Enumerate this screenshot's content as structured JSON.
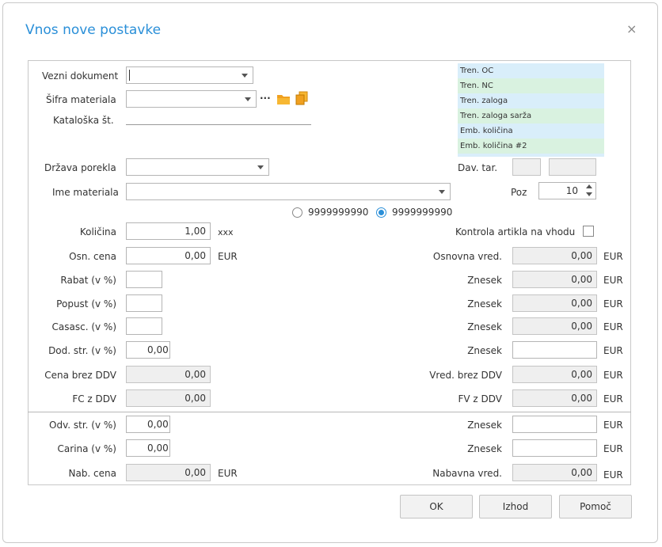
{
  "dialog": {
    "title": "Vnos nove postavke",
    "close": "×"
  },
  "top": {
    "vezni_label": "Vezni dokument",
    "sifra_label": "Šifra materiala",
    "kataloska_label": "Kataloška št.",
    "drzava_label": "Država porekla",
    "ime_label": "Ime materiala",
    "ellipsis": "···",
    "dav_tar_label": "Dav. tar.",
    "poz_label": "Poz",
    "poz_value": "10"
  },
  "list": [
    "Tren. OC",
    "Tren. NC",
    "Tren. zaloga",
    "Tren. zaloga sarža",
    "Emb. količina",
    "Emb. količina #2"
  ],
  "radios": {
    "option1": "9999999990",
    "option2": "9999999990"
  },
  "left": {
    "kolicina_label": "Količina",
    "kolicina_value": "1,00",
    "kolicina_unit": "xxx",
    "osn_cena_label": "Osn. cena",
    "osn_cena_value": "0,00",
    "osn_cena_unit": "EUR",
    "rabat_label": "Rabat (v %)",
    "popust_label": "Popust (v %)",
    "casasc_label": "Casasc. (v %)",
    "dod_str_label": "Dod. str. (v %)",
    "dod_str_value": "0,00",
    "cena_brez_label": "Cena brez DDV",
    "cena_brez_value": "0,00",
    "fc_label": "FC z DDV",
    "fc_value": "0,00",
    "odv_str_label": "Odv. str. (v %)",
    "odv_str_value": "0,00",
    "carina_label": "Carina (v %)",
    "carina_value": "0,00",
    "nab_cena_label": "Nab. cena",
    "nab_cena_value": "0,00",
    "nab_cena_unit": "EUR"
  },
  "right": {
    "kontrola_label": "Kontrola artikla na vhodu",
    "osnovna_label": "Osnovna vred.",
    "osnovna_value": "0,00",
    "znesek_label": "Znesek",
    "znesek1_value": "0,00",
    "znesek2_value": "0,00",
    "znesek3_value": "0,00",
    "vred_brez_label": "Vred. brez DDV",
    "vred_brez_value": "0,00",
    "fv_label": "FV z DDV",
    "fv_value": "0,00",
    "nabavna_label": "Nabavna vred.",
    "nabavna_value": "0,00",
    "unit": "EUR"
  },
  "buttons": {
    "ok": "OK",
    "izhod": "Izhod",
    "pomoc": "Pomoč"
  },
  "colors": {
    "accent": "#2a8fd8",
    "folder": "#f0a020",
    "list_blue": "#d9eefa",
    "list_green": "#d9f2e0"
  }
}
